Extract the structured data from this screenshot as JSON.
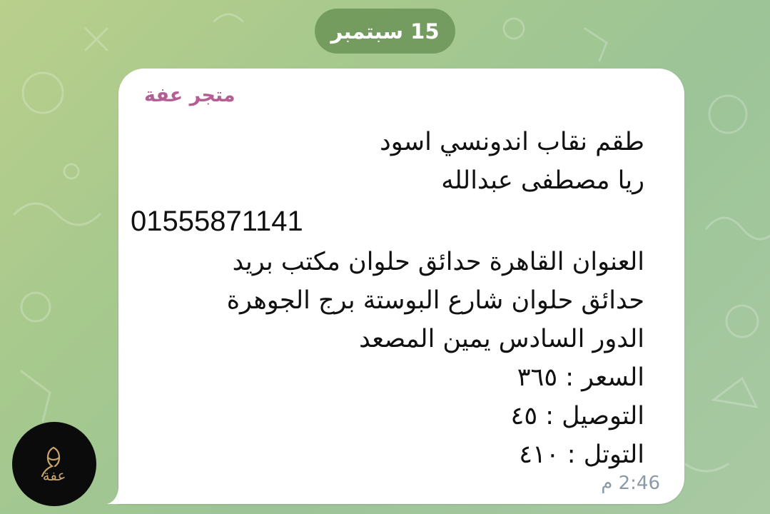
{
  "chat": {
    "date_label": "15 سبتمبر"
  },
  "message": {
    "sender": "متجر عفة",
    "lines": [
      "طقم نقاب اندونسي اسود",
      "ريا مصطفى عبدالله",
      "01555871141",
      "العنوان القاهرة حدائق حلوان مكتب بريد",
      "حدائق حلوان شارع البوستة برج الجوهرة",
      "الدور السادس يمين المصعد",
      "السعر : ٣٦٥",
      "التوصيل : ٤٥",
      "التوتل : ٤١٠"
    ],
    "time": "2:46 م"
  },
  "avatar": {
    "logo_text": "عفة",
    "icon": "store-logo"
  },
  "colors": {
    "sender": "#b35f94",
    "date_pill": "#6f9656",
    "timestamp": "#8a9aa8"
  }
}
